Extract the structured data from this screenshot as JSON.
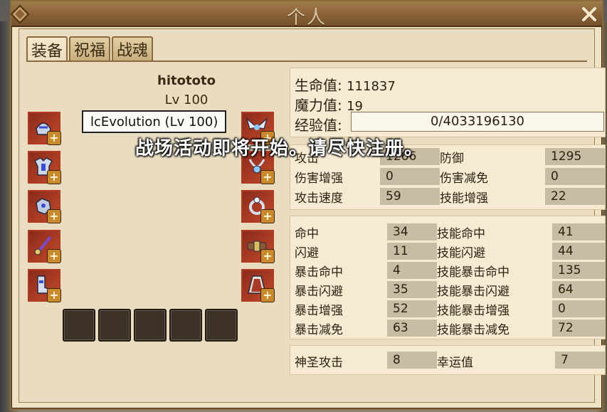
{
  "window": {
    "title": "个人"
  },
  "tabs": [
    "装备",
    "祝福",
    "战魂"
  ],
  "character": {
    "name": "hitototo",
    "level": "Lv 100"
  },
  "tooltip": "lcEvolution (Lv 100)",
  "notice": "战场活动即将开始。请尽快注册。",
  "vitals": {
    "hp_label": "生命值",
    "hp": "111837",
    "mp_label": "魔力值",
    "mp": "19",
    "xp_label": "经验值",
    "xp": "0/4033196130"
  },
  "stats_group1": {
    "left": [
      {
        "label": "攻击",
        "value": "1266"
      },
      {
        "label": "伤害增强",
        "value": "0"
      },
      {
        "label": "攻击速度",
        "value": "59"
      }
    ],
    "right": [
      {
        "label": "防御",
        "value": "1295"
      },
      {
        "label": "伤害减免",
        "value": "0"
      },
      {
        "label": "技能增强",
        "value": "22"
      }
    ]
  },
  "stats_group2": {
    "left": [
      {
        "label": "命中",
        "value": "34"
      },
      {
        "label": "闪避",
        "value": "11"
      },
      {
        "label": "暴击命中",
        "value": "4"
      },
      {
        "label": "暴击闪避",
        "value": "35"
      },
      {
        "label": "暴击增强",
        "value": "52"
      },
      {
        "label": "暴击减免",
        "value": "63"
      }
    ],
    "right": [
      {
        "label": "技能命中",
        "value": "41"
      },
      {
        "label": "技能闪避",
        "value": "44"
      },
      {
        "label": "技能暴击命中",
        "value": "135"
      },
      {
        "label": "技能暴击闪避",
        "value": "64"
      },
      {
        "label": "技能暴击增强",
        "value": "0"
      },
      {
        "label": "技能暴击减免",
        "value": "72"
      }
    ]
  },
  "stats_group3": {
    "left": {
      "label": "神圣攻击",
      "value": "8"
    },
    "right": {
      "label": "幸运值",
      "value": "7"
    }
  },
  "icons": {
    "close": "close-icon",
    "add": "+",
    "left_slots": [
      "helmet-icon",
      "armor-icon",
      "gloves-icon",
      "weapon-icon",
      "boots-icon"
    ],
    "right_slots": [
      "wings-icon",
      "necklace-icon",
      "ring-icon",
      "belt-icon",
      "cape-icon"
    ]
  },
  "colors": {
    "slot_border": "#b23a22",
    "panel_bg": "#f6ebd2",
    "value_box": "#c9bca5"
  }
}
